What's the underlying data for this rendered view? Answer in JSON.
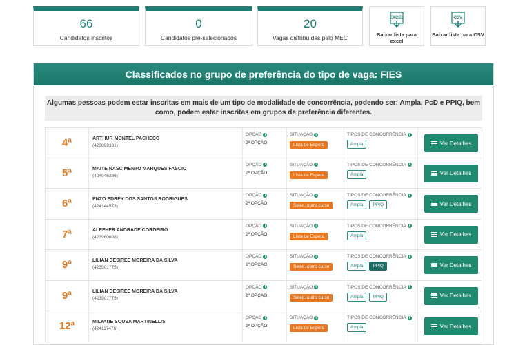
{
  "stats": [
    {
      "number": "66",
      "label": "Candidatos inscritos"
    },
    {
      "number": "0",
      "label": "Candidatos pré-selecionados"
    },
    {
      "number": "20",
      "label": "Vagas distribuídas pelo MEC"
    }
  ],
  "downloads": [
    {
      "icon_text": "EXCEL",
      "label": "Baixar lista para excel"
    },
    {
      "icon_text": "CSV",
      "label": "Baixar lista para CSV"
    }
  ],
  "panel": {
    "title": "Classificados no grupo de preferência do tipo de vaga: FIES",
    "notice": "Algumas pessoas podem estar inscritas em mais de um tipo de modalidade de concorrência, podendo ser: Ampla, PcD e PPIQ, bem como, podem estar inscritas em grupos de preferência diferentes."
  },
  "columns": {
    "option": "OPÇÃO",
    "status": "SITUAÇÃO",
    "types": "TIPOS DE CONCORRÊNCIA",
    "button": "Ver Detalhes"
  },
  "rows": [
    {
      "rank": "4ª",
      "name": "ARTHUR MONTEL PACHECO",
      "code": "(423899331)",
      "option": "2ª OPÇÃO",
      "status": "Lista de Espera",
      "types": [
        "Ampla"
      ]
    },
    {
      "rank": "5ª",
      "name": "MAITE NASCIMENTO MARQUES FASCIO",
      "code": "(424046386)",
      "option": "2ª OPÇÃO",
      "status": "Lista de Espera",
      "types": [
        "Ampla"
      ]
    },
    {
      "rank": "6ª",
      "name": "ENZO EDREY DOS SANTOS RODRIGUES",
      "code": "(424144573)",
      "option": "2ª OPÇÃO",
      "status": "Selec. outro curso",
      "types": [
        "Ampla",
        "PPIQ"
      ]
    },
    {
      "rank": "7ª",
      "name": "ALEFHER ANDRADE CORDEIRO",
      "code": "(423960008)",
      "option": "2ª OPÇÃO",
      "status": "Lista de Espera",
      "types": [
        "Ampla"
      ]
    },
    {
      "rank": "9ª",
      "name": "LILIAN DESIREE MOREIRA DA SILVA",
      "code": "(423901775)",
      "option": "1ª OPÇÃO",
      "status": "Selec. outro curso",
      "types": [
        "Ampla",
        "PPIQ"
      ],
      "dark_tag": "PPIQ"
    },
    {
      "rank": "9ª",
      "name": "LILIAN DESIREE MOREIRA DA SILVA",
      "code": "(423901775)",
      "option": "2ª OPÇÃO",
      "status": "Selec. outro curso",
      "types": [
        "Ampla",
        "PPIQ"
      ]
    },
    {
      "rank": "12ª",
      "name": "MILYANE SOUSA MARTINELLIS",
      "code": "(424117476)",
      "option": "2ª OPÇÃO",
      "status": "Lista de Espera",
      "types": [
        "Ampla"
      ]
    }
  ],
  "colors": {
    "accent": "#1f7f74",
    "orange": "#e87722",
    "button": "#1f8a6f"
  }
}
